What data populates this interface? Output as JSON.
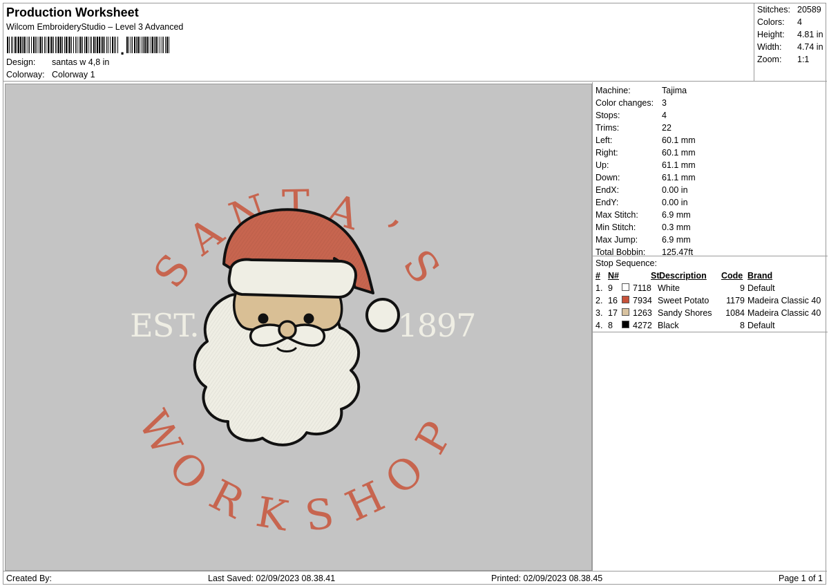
{
  "header": {
    "title": "Production Worksheet",
    "subtitle": "Wilcom EmbroideryStudio – Level 3 Advanced",
    "barcode_text": ",",
    "design_label": "Design:",
    "design_value": "santas w 4,8 in",
    "colorway_label": "Colorway:",
    "colorway_value": "Colorway 1"
  },
  "summary": [
    {
      "label": "Stitches:",
      "value": "20589"
    },
    {
      "label": "Colors:",
      "value": "4"
    },
    {
      "label": "Height:",
      "value": "4.81 in"
    },
    {
      "label": "Width:",
      "value": "4.74 in"
    },
    {
      "label": "Zoom:",
      "value": "1:1"
    }
  ],
  "artwork": {
    "top_text": [
      "S",
      "A",
      "N",
      "T",
      "A",
      "’",
      "S"
    ],
    "bottom_text": [
      "W",
      "O",
      "R",
      "K",
      "S",
      "H",
      "O",
      "P"
    ],
    "est_text": "EST.",
    "year_text": "1897",
    "colors": {
      "white": "#efeee4",
      "sweet_potato": "#c7654f",
      "sandy_shores": "#d9bf95",
      "black": "#111111",
      "background": "#c4c4c4"
    }
  },
  "details": [
    {
      "label": "Machine:",
      "value": "Tajima"
    },
    {
      "label": "Color changes:",
      "value": "3"
    },
    {
      "label": "Stops:",
      "value": "4"
    },
    {
      "label": "Trims:",
      "value": "22"
    },
    {
      "label": "Left:",
      "value": "60.1 mm"
    },
    {
      "label": "Right:",
      "value": "60.1 mm"
    },
    {
      "label": "Up:",
      "value": "61.1 mm"
    },
    {
      "label": "Down:",
      "value": "61.1 mm"
    },
    {
      "label": "EndX:",
      "value": "0.00 in"
    },
    {
      "label": "EndY:",
      "value": "0.00 in"
    },
    {
      "label": "Max Stitch:",
      "value": "6.9 mm"
    },
    {
      "label": "Min Stitch:",
      "value": "0.3 mm"
    },
    {
      "label": "Max Jump:",
      "value": "6.9 mm"
    },
    {
      "label": "Total Bobbin:",
      "value": "125.47ft"
    }
  ],
  "stop_sequence": {
    "title": "Stop Sequence:",
    "headers": {
      "num": "#",
      "n": "N#",
      "st": "St.",
      "description": "Description",
      "code": "Code",
      "brand": "Brand"
    },
    "rows": [
      {
        "num": "1.",
        "n": "9",
        "color": "#ffffff",
        "st": "7118",
        "description": "White",
        "code": "9",
        "brand": "Default"
      },
      {
        "num": "2.",
        "n": "16",
        "color": "#c7523a",
        "st": "7934",
        "description": "Sweet Potato",
        "code": "1179",
        "brand": "Madeira Classic 40"
      },
      {
        "num": "3.",
        "n": "17",
        "color": "#d9c3a0",
        "st": "1263",
        "description": "Sandy Shores",
        "code": "1084",
        "brand": "Madeira Classic 40"
      },
      {
        "num": "4.",
        "n": "8",
        "color": "#000000",
        "st": "4272",
        "description": "Black",
        "code": "8",
        "brand": "Default"
      }
    ]
  },
  "footer": {
    "created_by": "Created By:",
    "last_saved": "Last Saved: 02/09/2023 08.38.41",
    "printed": "Printed: 02/09/2023 08.38.45",
    "page": "Page 1 of 1"
  }
}
